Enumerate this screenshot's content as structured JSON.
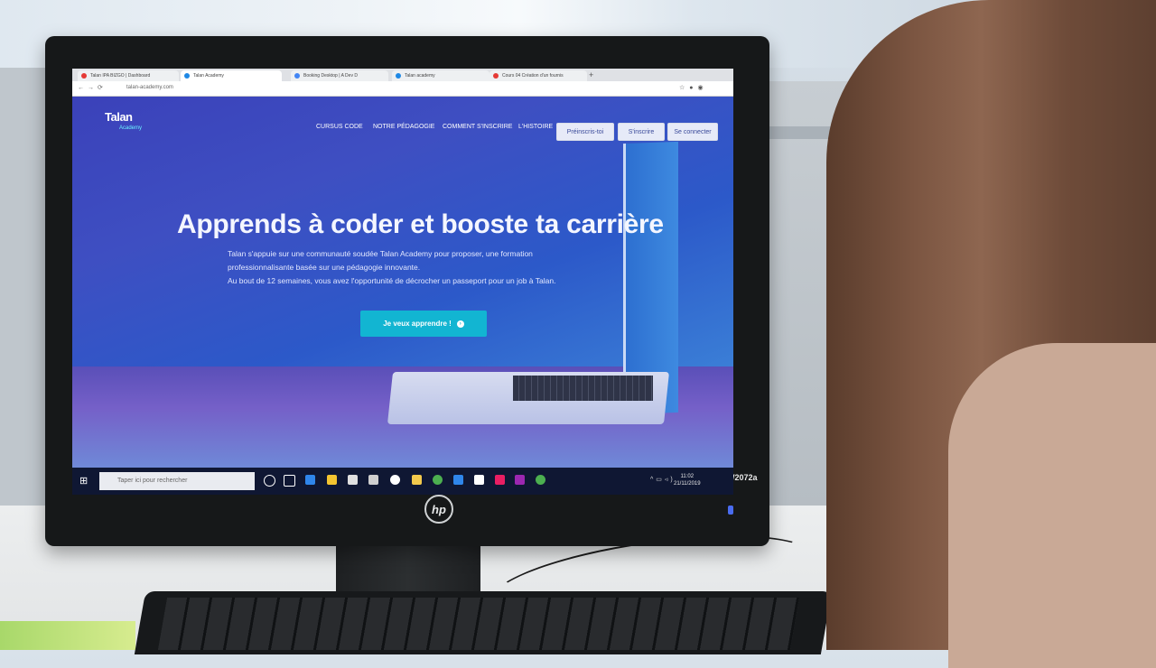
{
  "browser": {
    "tabs": [
      {
        "label": "Talan IPA BIZGO | Dashboard",
        "color": "#e53935"
      },
      {
        "label": "Talan Academy",
        "color": "#1e88e5",
        "active": true
      },
      {
        "label": "Booking Desktop | A Dev D",
        "color": "#4285f4"
      },
      {
        "label": "Talan academy",
        "color": "#1e88e5"
      },
      {
        "label": "Cours 04 Création d'un fournis",
        "color": "#e53935"
      }
    ],
    "url": "talan-academy.com"
  },
  "site": {
    "logo": "Talan",
    "logo_sub": "Academy",
    "nav": [
      "CURSUS CODE",
      "NOTRE PÉDAGOGIE",
      "COMMENT S'INSCRIRE",
      "L'HISTOIRE"
    ],
    "buttons": [
      "Préinscris-toi",
      "S'inscrire",
      "Se connecter"
    ]
  },
  "hero": {
    "title": "Apprends à coder et booste ta carrière",
    "lines": [
      "Talan s'appuie sur une communauté soudée Talan Academy pour proposer, une formation",
      "professionnalisante basée sur une pédagogie innovante.",
      "Au bout de 12 semaines, vous avez l'opportunité de décrocher un passeport pour un job à Talan."
    ],
    "cta": "Je veux apprendre !"
  },
  "taskbar": {
    "search_placeholder": "Taper ici pour rechercher",
    "time": "11:02",
    "date": "21/11/2019",
    "icon_colors": [
      "#ffffff",
      "#ffffff",
      "#2f86eb",
      "#f4c430",
      "#e0e0e0",
      "#cfcfcf",
      "#ffffff",
      "#f2c94c",
      "#4caf50",
      "#2f86eb",
      "#ffffff",
      "#e91e63",
      "#9c27b0",
      "#4caf50"
    ]
  },
  "monitor": {
    "brand": "hp",
    "model": "W2072a"
  }
}
